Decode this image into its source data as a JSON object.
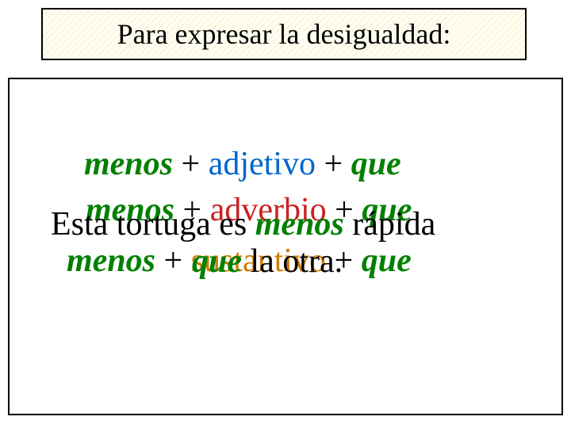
{
  "title": "Para expresar la desigualdad:",
  "line1": {
    "menos": "menos ",
    "plus1": " + ",
    "adjetivo": "adjetivo",
    "plus2": " + ",
    "que": "que"
  },
  "line2": {
    "menos": "menos ",
    "plus1": " + ",
    "adverbio": "adverbio",
    "plus2": " + ",
    "que": "que"
  },
  "line3": {
    "pre": "Esta tortuga es ",
    "menos": "menos",
    "post": " rápida"
  },
  "line4": {
    "menos": "menos",
    "plus1": " + ",
    "sustantivo": "sustantivo",
    "plus2": " + ",
    "que": "que"
  },
  "line5": {
    "que": "que",
    "post": " la otra."
  }
}
